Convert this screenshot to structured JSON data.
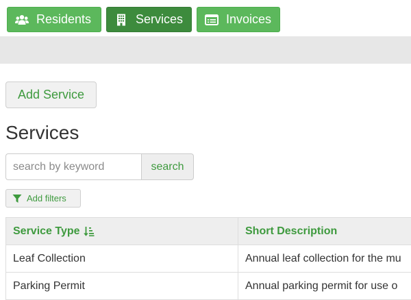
{
  "nav": {
    "items": [
      {
        "label": "Residents",
        "icon": "users-icon"
      },
      {
        "label": "Services",
        "icon": "building-icon",
        "active": true
      },
      {
        "label": "Invoices",
        "icon": "invoice-icon"
      }
    ]
  },
  "actions": {
    "add_service_label": "Add Service"
  },
  "page": {
    "title": "Services"
  },
  "search": {
    "placeholder": "search by keyword",
    "value": "",
    "button_label": "search"
  },
  "filters": {
    "label": "Add filters",
    "icon": "filter-icon"
  },
  "table": {
    "columns": [
      {
        "label": "Service Type",
        "sort_icon": "sort-amount-asc-icon"
      },
      {
        "label": "Short Description"
      }
    ],
    "rows": [
      {
        "service_type": "Leaf Collection",
        "description": "Annual leaf collection for the mu"
      },
      {
        "service_type": "Parking Permit",
        "description": "Annual parking permit for use o"
      }
    ]
  },
  "colors": {
    "nav_green": "#5cb85c",
    "nav_green_active": "#3d8b3d",
    "link_green": "#3e9a3e",
    "toolbar_gray": "#e7e7e7"
  }
}
